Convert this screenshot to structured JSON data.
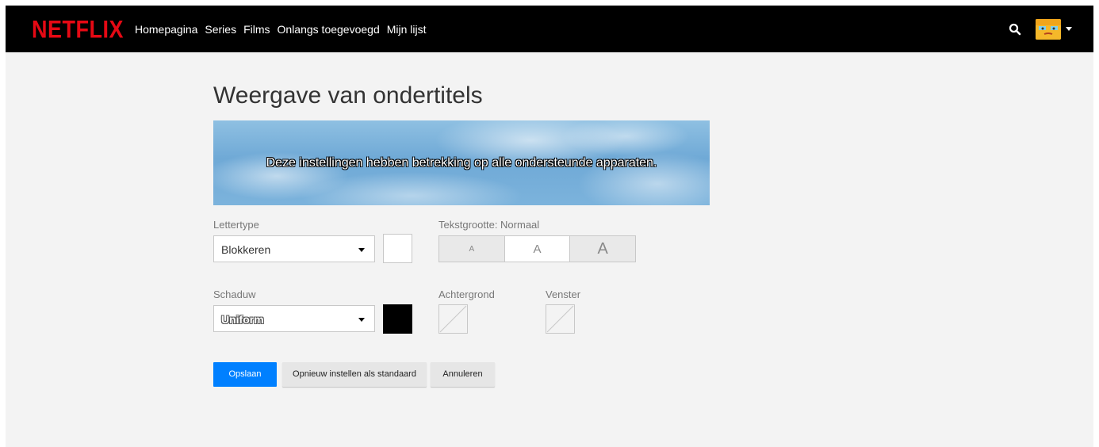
{
  "header": {
    "logo": "NETFLIX",
    "nav": [
      "Homepagina",
      "Series",
      "Films",
      "Onlangs toegevoegd",
      "Mijn lijst"
    ],
    "icons": {
      "search": "search-icon",
      "avatar": "profile-avatar",
      "menu": "caret-down-icon"
    },
    "logo_color": "#e50914"
  },
  "page": {
    "title": "Weergave van ondertitels",
    "preview_text": "Deze instellingen hebben betrekking op alle ondersteunde apparaten."
  },
  "settings": {
    "font": {
      "label": "Lettertype",
      "value": "Blokkeren",
      "color": "#ffffff"
    },
    "text_size": {
      "label": "Tekstgrootte: Normaal",
      "options": [
        "A",
        "A",
        "A"
      ],
      "selected": "Normaal"
    },
    "shadow": {
      "label": "Schaduw",
      "value": "Uniform",
      "color": "#000000"
    },
    "background": {
      "label": "Achtergrond"
    },
    "window": {
      "label": "Venster"
    }
  },
  "buttons": {
    "save": "Opslaan",
    "reset": "Opnieuw instellen als standaard",
    "cancel": "Annuleren"
  },
  "colors": {
    "primary": "#0080ff",
    "page_bg": "#f3f3f3"
  }
}
